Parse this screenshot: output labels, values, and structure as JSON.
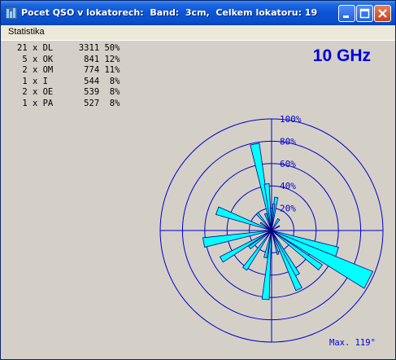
{
  "window": {
    "title": "Pocet QSO v lokatorech:  Band:  3cm,  Celkem lokatoru: 19"
  },
  "menu": {
    "items": [
      {
        "label": "Statistika"
      }
    ]
  },
  "stats": [
    {
      "count": "21",
      "prefix": "DL",
      "qso": "3311",
      "pct": "50%"
    },
    {
      "count": "5",
      "prefix": "OK",
      "qso": "841",
      "pct": "12%"
    },
    {
      "count": "2",
      "prefix": "OM",
      "qso": "774",
      "pct": "11%"
    },
    {
      "count": "1",
      "prefix": "I",
      "qso": "544",
      "pct": "8%"
    },
    {
      "count": "2",
      "prefix": "OE",
      "qso": "539",
      "pct": "8%"
    },
    {
      "count": "1",
      "prefix": "PA",
      "qso": "527",
      "pct": "8%"
    }
  ],
  "band_label": "10 GHz",
  "max_label": "Max. 119°",
  "polar": {
    "ring_labels": [
      "100%",
      "80%",
      "60%",
      "40%",
      "20%"
    ],
    "colors": {
      "grid": "#0000cc",
      "fill": "#00ffff",
      "outline": "#000080"
    },
    "lobes": [
      {
        "bearing_deg": -11,
        "width_deg": 3,
        "value": 0.79
      },
      {
        "bearing_deg": -6,
        "width_deg": 3,
        "value": 0.42
      },
      {
        "bearing_deg": 8,
        "width_deg": 3,
        "value": 0.3
      },
      {
        "bearing_deg": 5,
        "width_deg": 2,
        "value": 0.24
      },
      {
        "bearing_deg": 32,
        "width_deg": 5,
        "value": 0.12
      },
      {
        "bearing_deg": 60,
        "width_deg": 3,
        "value": 0.08
      },
      {
        "bearing_deg": 108,
        "width_deg": 4,
        "value": 0.62
      },
      {
        "bearing_deg": 117,
        "width_deg": 5,
        "value": 0.98
      },
      {
        "bearing_deg": 127,
        "width_deg": 3,
        "value": 0.55
      },
      {
        "bearing_deg": 150,
        "width_deg": 3,
        "value": 0.46
      },
      {
        "bearing_deg": 155,
        "width_deg": 3,
        "value": 0.58
      },
      {
        "bearing_deg": 165,
        "width_deg": 2,
        "value": 0.22
      },
      {
        "bearing_deg": 185,
        "width_deg": 3,
        "value": 0.62
      },
      {
        "bearing_deg": 193,
        "width_deg": 3,
        "value": 0.25
      },
      {
        "bearing_deg": 215,
        "width_deg": 3,
        "value": 0.42
      },
      {
        "bearing_deg": 232,
        "width_deg": 3,
        "value": 0.25
      },
      {
        "bearing_deg": 240,
        "width_deg": 3,
        "value": 0.52
      },
      {
        "bearing_deg": 260,
        "width_deg": 4,
        "value": 0.62
      },
      {
        "bearing_deg": 290,
        "width_deg": 4,
        "value": 0.52
      },
      {
        "bearing_deg": 305,
        "width_deg": 3,
        "value": 0.12
      },
      {
        "bearing_deg": 320,
        "width_deg": 3,
        "value": 0.2
      },
      {
        "bearing_deg": 340,
        "width_deg": 3,
        "value": 0.16
      }
    ]
  }
}
